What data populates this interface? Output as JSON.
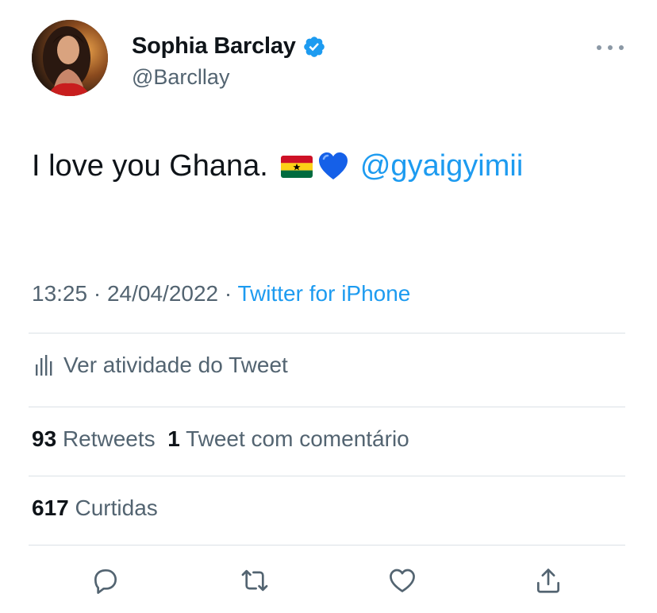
{
  "author": {
    "name": "Sophia Barclay",
    "handle": "@Barcllay",
    "verified": true
  },
  "tweet": {
    "text": "I love you Ghana.",
    "emojis": [
      "ghana-flag-emoji",
      "blue-heart-emoji"
    ],
    "mention": "@gyaigyimii"
  },
  "meta": {
    "time": "13:25",
    "separator1": " · ",
    "date": "24/04/2022",
    "separator2": " · ",
    "source": "Twitter for iPhone"
  },
  "activity": {
    "label": "Ver atividade do Tweet",
    "icon": "analytics-icon"
  },
  "stats": {
    "retweets_count": "93",
    "retweets_label": "Retweets",
    "quotes_count": "1",
    "quotes_label": "Tweet com comentário",
    "likes_count": "617",
    "likes_label": "Curtidas"
  },
  "actions": [
    "reply-icon",
    "retweet-icon",
    "like-icon",
    "share-icon"
  ],
  "colors": {
    "accent": "#1d9bf0",
    "text": "#0f1419",
    "secondary": "#536471",
    "divider": "#dbe1e6"
  }
}
